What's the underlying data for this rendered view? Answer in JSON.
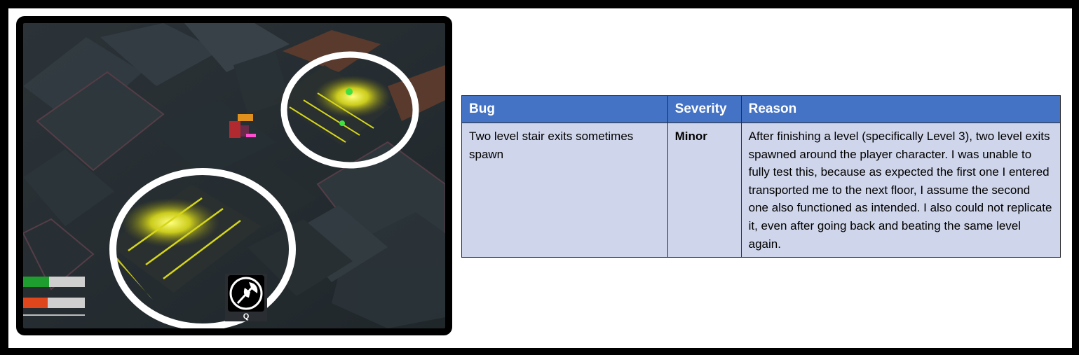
{
  "screenshot": {
    "description_icons": {
      "ability": "axe-icon"
    },
    "hud": {
      "health_fraction": 0.42,
      "stamina_fraction": 0.4,
      "health_color": "#1e9e2e",
      "stamina_color": "#e0461c",
      "ability_key": "Q"
    },
    "highlight_color": "#ffffff",
    "stair_glow_color": "#e8e81a"
  },
  "table": {
    "headers": {
      "bug": "Bug",
      "severity": "Severity",
      "reason": "Reason"
    },
    "rows": [
      {
        "bug": "Two level stair exits sometimes spawn",
        "severity": "Minor",
        "reason": "After finishing a level (specifically Level 3), two level exits spawned around the player character. I was unable to fully test this, because as expected the first one I entered transported me to the next floor, I assume the second one also functioned as intended. I also could not replicate it, even after going back and beating the same level again."
      }
    ],
    "header_color": "#4472c4",
    "row_color": "#cfd5ea"
  }
}
